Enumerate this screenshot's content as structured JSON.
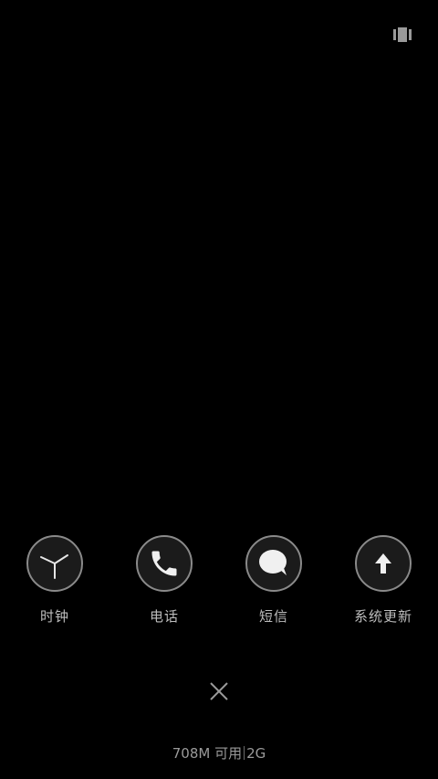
{
  "top_toggle": {
    "icon": "view-toggle-icon"
  },
  "apps": [
    {
      "label": "时钟",
      "icon": "clock-icon"
    },
    {
      "label": "电话",
      "icon": "phone-icon"
    },
    {
      "label": "短信",
      "icon": "message-icon"
    },
    {
      "label": "系统更新",
      "icon": "upload-arrow-icon"
    }
  ],
  "close": {
    "icon": "close-icon"
  },
  "memory": {
    "available": "708M 可用",
    "total": "2G"
  },
  "colors": {
    "background": "#000000",
    "circle_border": "#8a8a8a",
    "label_text": "#bdbdbd"
  }
}
